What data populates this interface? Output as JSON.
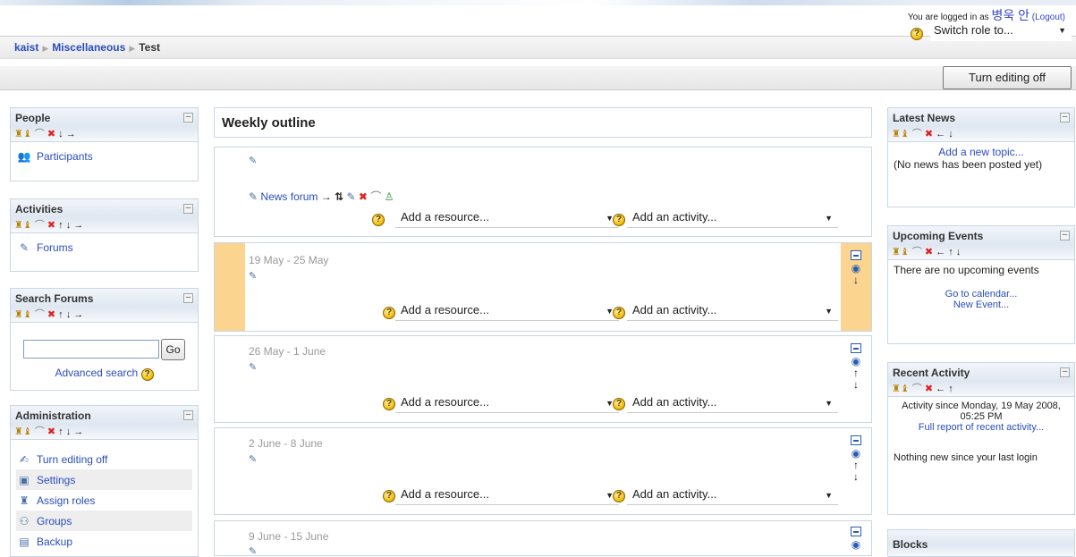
{
  "header": {
    "login_prefix": "You are logged in as",
    "user_name": "병욱 안",
    "logout": "(Logout)",
    "switch_role": "Switch role to...",
    "turn_editing_off": "Turn editing off"
  },
  "breadcrumb": {
    "home": "kaist",
    "category": "Miscellaneous",
    "current": "Test"
  },
  "left_blocks": {
    "people": {
      "title": "People",
      "items": [
        "Participants"
      ]
    },
    "activities": {
      "title": "Activities",
      "items": [
        "Forums"
      ]
    },
    "search": {
      "title": "Search Forums",
      "go": "Go",
      "advanced": "Advanced search"
    },
    "admin": {
      "title": "Administration",
      "items": [
        "Turn editing off",
        "Settings",
        "Assign roles",
        "Groups",
        "Backup"
      ]
    }
  },
  "main": {
    "title": "Weekly outline",
    "news_forum": "News forum",
    "add_resource": "Add a resource...",
    "add_activity": "Add an activity...",
    "weeks": [
      "19 May - 25 May",
      "26 May - 1 June",
      "2 June - 8 June",
      "9 June - 15 June"
    ]
  },
  "right_blocks": {
    "news": {
      "title": "Latest News",
      "add_topic": "Add a new topic...",
      "empty": "(No news has been posted yet)"
    },
    "events": {
      "title": "Upcoming Events",
      "empty": "There are no upcoming events",
      "calendar": "Go to calendar...",
      "new_event": "New Event..."
    },
    "recent": {
      "title": "Recent Activity",
      "since": "Activity since Monday, 19 May 2008, 05:25 PM",
      "full_report": "Full report of recent activity...",
      "nothing": "Nothing new since your last login"
    },
    "blocks": {
      "title": "Blocks"
    }
  },
  "icons": {
    "help": "help-icon",
    "roles": "roles-icon",
    "hide": "eye-icon",
    "delete": "delete-icon",
    "move": "arrow-icon"
  },
  "colors": {
    "link": "#2a4dbb",
    "current_week": "#fbd48f",
    "block_header": "#dfe7f1",
    "delete": "#e02020"
  }
}
